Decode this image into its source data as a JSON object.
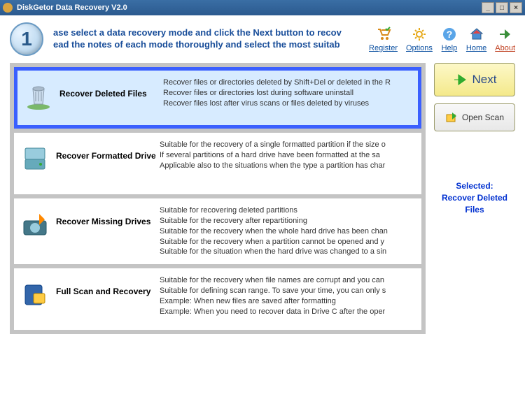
{
  "title": "DiskGetor Data Recovery V2.0",
  "instruction_line1": "ase select a data recovery mode and click the Next button to recov",
  "instruction_line2": "ead the notes of each mode thoroughly and select the most suitab",
  "step_number": "1",
  "toolbar": {
    "register": "Register",
    "options": "Options",
    "help": "Help",
    "home": "Home",
    "about": "About"
  },
  "modes": [
    {
      "title": "Recover Deleted Files",
      "descs": [
        "Recover files or directories deleted by Shift+Del or deleted in the R",
        "Recover files or directories lost during software uninstall",
        "Recover files lost after virus scans or files deleted by viruses"
      ]
    },
    {
      "title": "Recover Formatted Drive",
      "descs": [
        "Suitable for the recovery of a single formatted partition if the size o",
        "If several partitions of a hard drive have been formatted at the sa",
        "Applicable also to the situations when the type a partition has char"
      ]
    },
    {
      "title": "Recover Missing Drives",
      "descs": [
        "Suitable for recovering deleted partitions",
        "Suitable for the recovery after repartitioning",
        "Suitable for the recovery when the whole hard drive has been chan",
        "Suitable for the recovery when a partition cannot be opened and y",
        "Suitable for the situation when the hard drive was changed to a sin"
      ]
    },
    {
      "title": "Full Scan and Recovery",
      "descs": [
        "Suitable for the recovery when file names are corrupt and you can",
        "Suitable for defining scan range. To save your time, you can only s",
        "Example: When new files are saved after formatting",
        "Example: When you need to recover data in Drive C after the oper"
      ]
    }
  ],
  "buttons": {
    "next": "Next",
    "openscan": "Open Scan"
  },
  "status": {
    "line1": "Selected:",
    "line2": "Recover Deleted",
    "line3": "Files"
  }
}
